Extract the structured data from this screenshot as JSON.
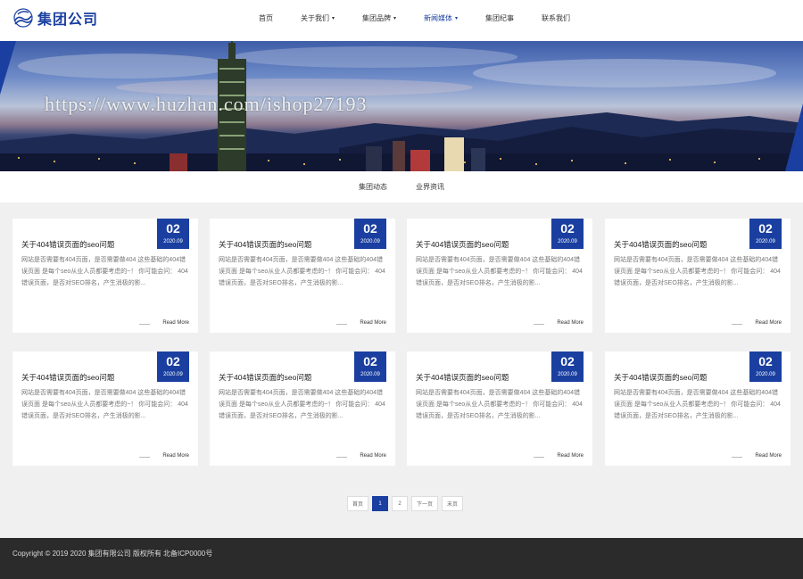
{
  "header": {
    "logo_text": "集团公司",
    "nav": [
      {
        "label": "首页",
        "has_caret": false,
        "active": false
      },
      {
        "label": "关于我们",
        "has_caret": true,
        "active": false
      },
      {
        "label": "集团品牌",
        "has_caret": true,
        "active": false
      },
      {
        "label": "新闻媒体",
        "has_caret": true,
        "active": true
      },
      {
        "label": "集团纪事",
        "has_caret": false,
        "active": false
      },
      {
        "label": "联系我们",
        "has_caret": false,
        "active": false
      }
    ],
    "caret_glyph": "▾"
  },
  "banner": {
    "watermark": "https://www.huzhan.com/ishop27193"
  },
  "subtabs": [
    "集团动态",
    "业界资讯"
  ],
  "cards": [
    {
      "day": "02",
      "ym": "2020.09",
      "title": "关于404错误页面的seo问题",
      "desc": "网站是否需要有404页面，是否需要做404 这些基础的404错误页面 是每个seo从业人员都要考虑的~！ 你可能会问： 404错误页面，是否对SEO排名，产生消极的影..."
    },
    {
      "day": "02",
      "ym": "2020.09",
      "title": "关于404错误页面的seo问题",
      "desc": "网站是否需要有404页面，是否需要做404 这些基础的404错误页面 是每个seo从业人员都要考虑的~！ 你可能会问： 404错误页面，是否对SEO排名，产生消极的影..."
    },
    {
      "day": "02",
      "ym": "2020.09",
      "title": "关于404错误页面的seo问题",
      "desc": "网站是否需要有404页面，是否需要做404 这些基础的404错误页面 是每个seo从业人员都要考虑的~！ 你可能会问： 404错误页面，是否对SEO排名，产生消极的影..."
    },
    {
      "day": "02",
      "ym": "2020.09",
      "title": "关于404错误页面的seo问题",
      "desc": "网站是否需要有404页面，是否需要做404 这些基础的404错误页面 是每个seo从业人员都要考虑的~！ 你可能会问： 404错误页面，是否对SEO排名，产生消极的影..."
    },
    {
      "day": "02",
      "ym": "2020.09",
      "title": "关于404错误页面的seo问题",
      "desc": "网站是否需要有404页面，是否需要做404 这些基础的404错误页面 是每个seo从业人员都要考虑的~！ 你可能会问： 404错误页面，是否对SEO排名，产生消极的影..."
    },
    {
      "day": "02",
      "ym": "2020.09",
      "title": "关于404错误页面的seo问题",
      "desc": "网站是否需要有404页面，是否需要做404 这些基础的404错误页面 是每个seo从业人员都要考虑的~！ 你可能会问： 404错误页面，是否对SEO排名，产生消极的影..."
    },
    {
      "day": "02",
      "ym": "2020.09",
      "title": "关于404错误页面的seo问题",
      "desc": "网站是否需要有404页面，是否需要做404 这些基础的404错误页面 是每个seo从业人员都要考虑的~！ 你可能会问： 404错误页面，是否对SEO排名，产生消极的影..."
    },
    {
      "day": "02",
      "ym": "2020.09",
      "title": "关于404错误页面的seo问题",
      "desc": "网站是否需要有404页面，是否需要做404 这些基础的404错误页面 是每个seo从业人员都要考虑的~！ 你可能会问： 404错误页面，是否对SEO排名，产生消极的影..."
    }
  ],
  "read_more_label": "Read More",
  "pagination": {
    "first": "首页",
    "pages": [
      "1",
      "2"
    ],
    "current": "1",
    "next": "下一页",
    "last": "末页"
  },
  "footer": {
    "copyright": "Copyright © 2019 2020 集团有限公司 版权所有 北备ICP0000号"
  },
  "colors": {
    "brand": "#1a3fa0",
    "footer_bg": "#2b2b2b"
  }
}
